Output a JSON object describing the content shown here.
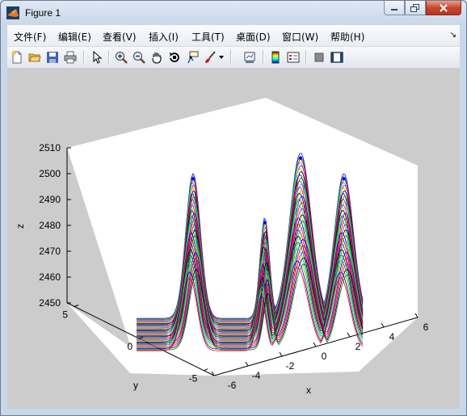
{
  "window": {
    "title": "Figure 1"
  },
  "menu": {
    "items": [
      "文件(F)",
      "编辑(E)",
      "查看(V)",
      "插入(I)",
      "工具(T)",
      "桌面(D)",
      "窗口(W)",
      "帮助(H)"
    ]
  },
  "toolbar": {
    "buttons": [
      "new-figure",
      "open-file",
      "save-figure",
      "print-figure",
      "edit-plot",
      "zoom-in",
      "zoom-out",
      "pan",
      "rotate-3d",
      "data-cursor",
      "brush",
      "link-plot",
      "insert-colorbar",
      "insert-legend",
      "hide-plot-tools",
      "show-plot-tools"
    ]
  },
  "chart_data": {
    "type": "line",
    "projection": "3d-surface-mesh",
    "title": "",
    "xlabel": "x",
    "ylabel": "y",
    "zlabel": "z",
    "x_ticks": [
      "-6",
      "-4",
      "-2",
      "0",
      "2",
      "4",
      "6"
    ],
    "y_ticks": [
      "-5",
      "0",
      "5"
    ],
    "z_ticks": [
      "2450",
      "2460",
      "2470",
      "2480",
      "2490",
      "2500",
      "2510"
    ],
    "zlim": [
      2450,
      2510
    ],
    "xlim": [
      -6,
      6
    ],
    "ylim": [
      -6,
      6
    ],
    "series_colors": [
      "#0000ff",
      "#008000",
      "#ff0000",
      "#00bfbf",
      "#bf00bf",
      "#bfbf00",
      "#000000"
    ],
    "peaks": [
      {
        "x": -3.0,
        "z": 2498
      },
      {
        "x": 0.8,
        "z": 2481
      },
      {
        "x": 2.7,
        "z": 2506
      },
      {
        "x": 5.0,
        "z": 2498
      }
    ],
    "grid": false,
    "background": "#ffffff"
  }
}
